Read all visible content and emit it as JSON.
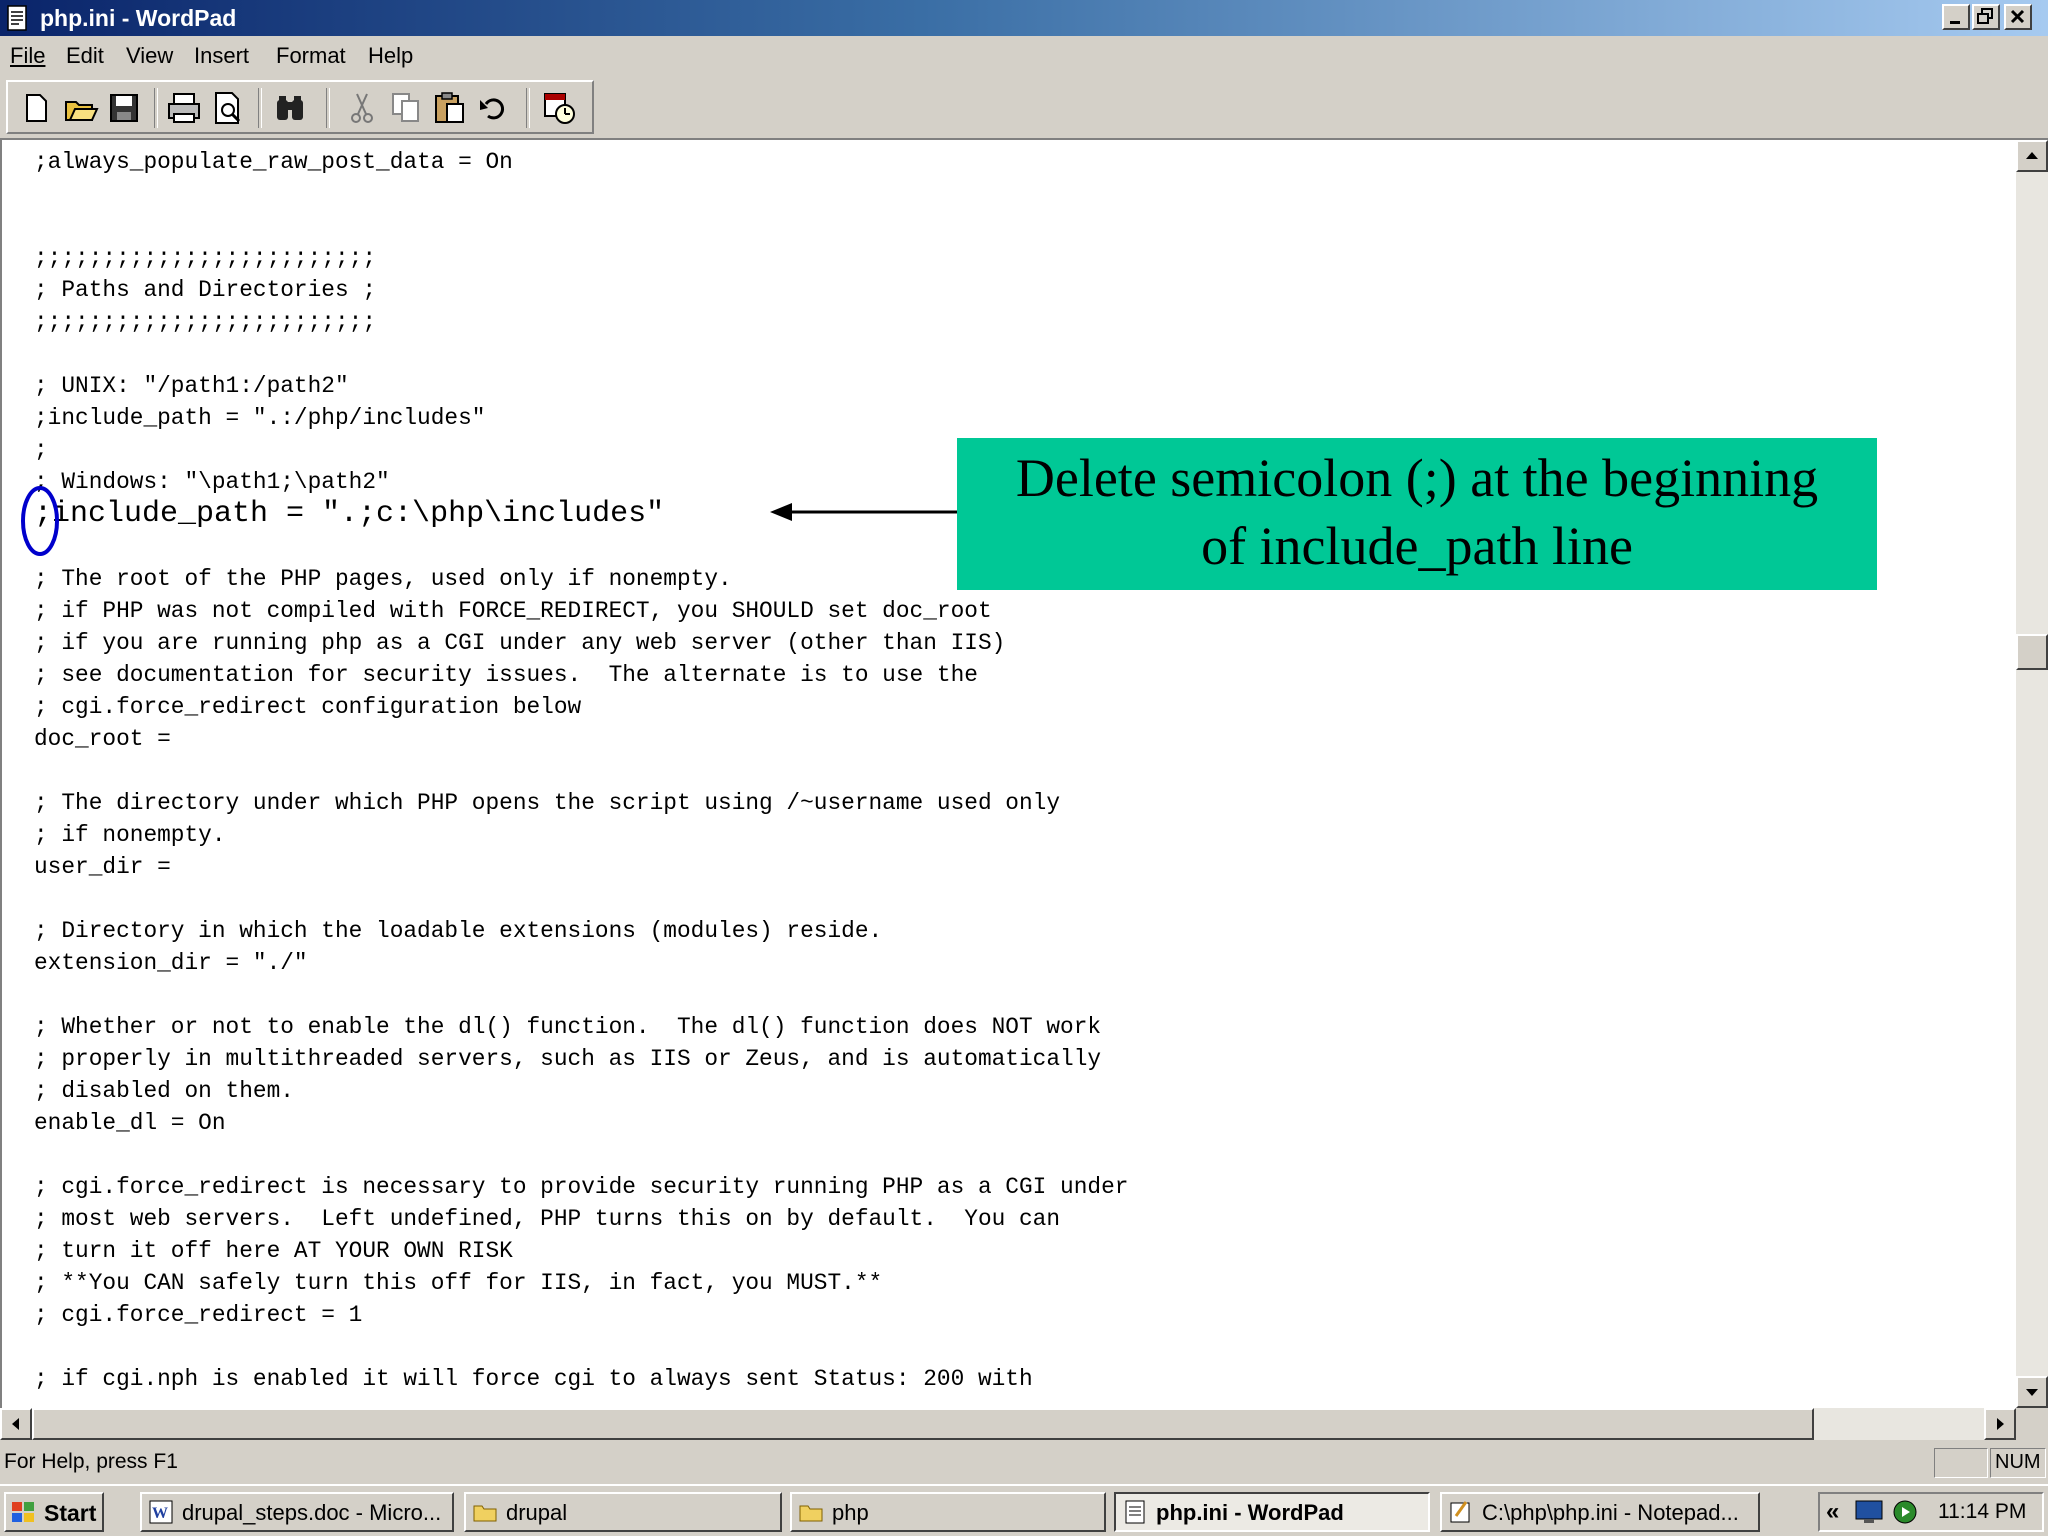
{
  "window": {
    "title": "php.ini - WordPad",
    "icon": "wordpad-document-icon"
  },
  "menu": [
    "File",
    "Edit",
    "View",
    "Insert",
    "Format",
    "Help"
  ],
  "toolbar": {
    "icons": [
      "new-icon",
      "open-icon",
      "save-icon",
      "print-icon",
      "print-preview-icon",
      "find-icon",
      "cut-icon",
      "copy-icon",
      "paste-icon",
      "undo-icon",
      "date-time-icon"
    ]
  },
  "document": {
    "lines": [
      ";always_populate_raw_post_data = On",
      "",
      "",
      ";;;;;;;;;;;;;;;;;;;;;;;;;",
      "; Paths and Directories ;",
      ";;;;;;;;;;;;;;;;;;;;;;;;;",
      "",
      "; UNIX: \"/path1:/path2\"",
      ";include_path = \".:/php/includes\"",
      ";",
      "; Windows: \"\\path1;\\path2\"",
      ";include_path = \".;c:\\php\\includes\"",
      "",
      "; The root of the PHP pages, used only if nonempty.",
      "; if PHP was not compiled with FORCE_REDIRECT, you SHOULD set doc_root",
      "; if you are running php as a CGI under any web server (other than IIS)",
      "; see documentation for security issues.  The alternate is to use the",
      "; cgi.force_redirect configuration below",
      "doc_root =",
      "",
      "; The directory under which PHP opens the script using /~username used only",
      "; if nonempty.",
      "user_dir =",
      "",
      "; Directory in which the loadable extensions (modules) reside.",
      "extension_dir = \"./\"",
      "",
      "; Whether or not to enable the dl() function.  The dl() function does NOT work",
      "; properly in multithreaded servers, such as IIS or Zeus, and is automatically",
      "; disabled on them.",
      "enable_dl = On",
      "",
      "; cgi.force_redirect is necessary to provide security running PHP as a CGI under",
      "; most web servers.  Left undefined, PHP turns this on by default.  You can",
      "; turn it off here AT YOUR OWN RISK",
      "; **You CAN safely turn this off for IIS, in fact, you MUST.**",
      "; cgi.force_redirect = 1",
      "",
      "; if cgi.nph is enabled it will force cgi to always sent Status: 200 with"
    ]
  },
  "annotation": {
    "line1": "Delete semicolon (;) at the beginning",
    "line2": "of include_path line",
    "color": "#00c896",
    "circle_color": "#0000cc"
  },
  "status": {
    "help_text": "For Help, press F1",
    "num_indicator": "NUM"
  },
  "taskbar": {
    "start_label": "Start",
    "tasks": [
      {
        "label": "drupal_steps.doc - Micro...",
        "icon": "word-document-icon",
        "active": false
      },
      {
        "label": "drupal",
        "icon": "folder-icon",
        "active": false
      },
      {
        "label": "php",
        "icon": "folder-icon",
        "active": false
      },
      {
        "label": "php.ini - WordPad",
        "icon": "wordpad-document-icon",
        "active": true
      },
      {
        "label": "C:\\php\\php.ini - Notepad...",
        "icon": "notepad-icon",
        "active": false
      }
    ],
    "tray_expand": "«",
    "clock": "11:14 PM"
  }
}
